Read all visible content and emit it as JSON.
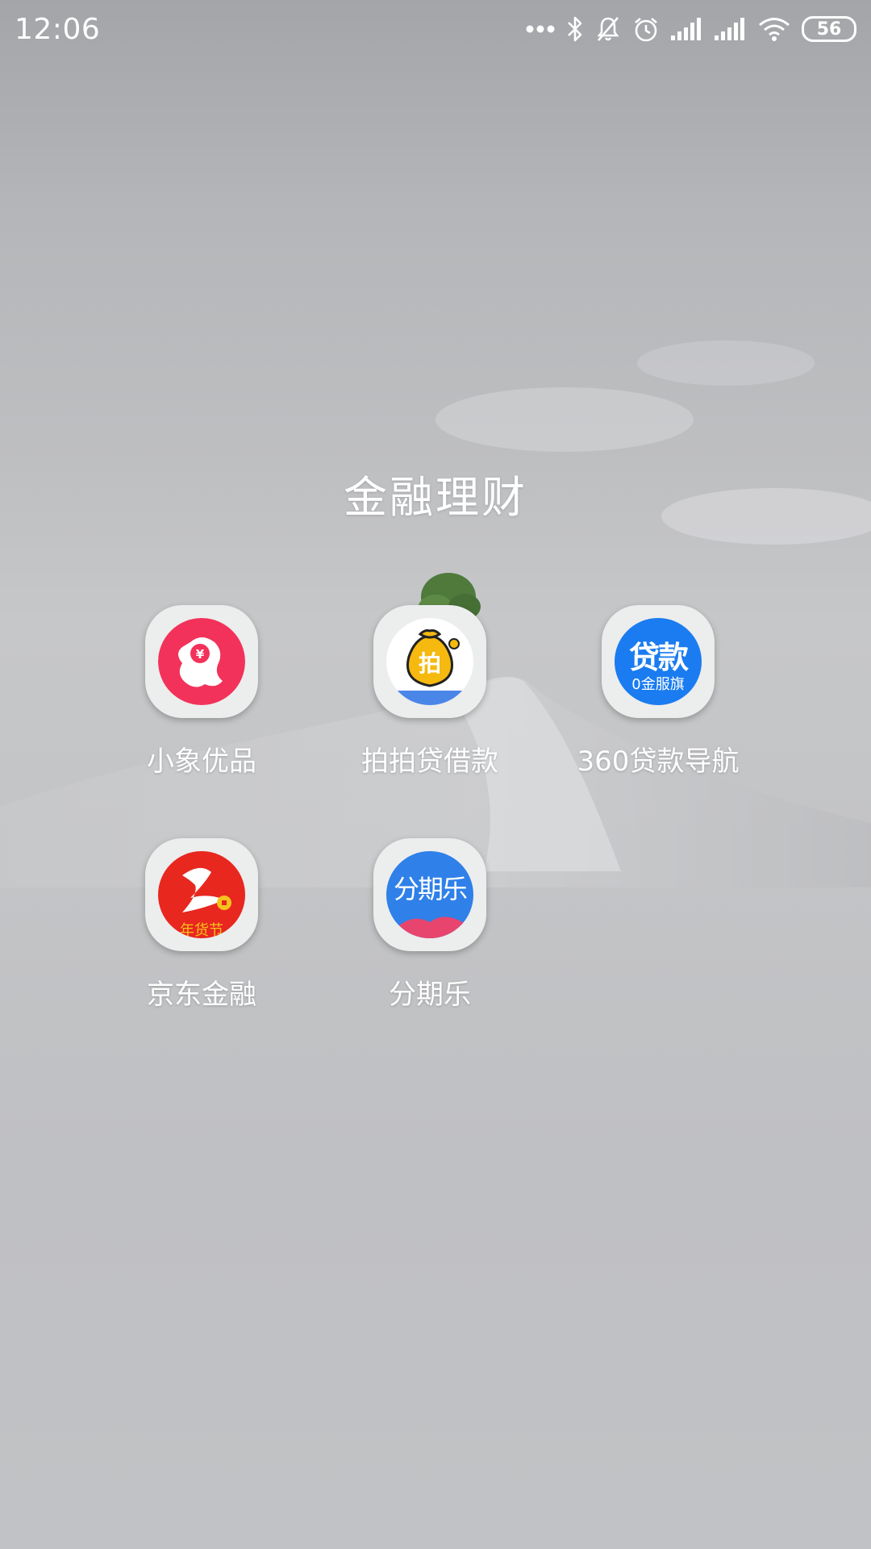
{
  "status_bar": {
    "time": "12:06",
    "battery": "56",
    "icons": [
      "more-dots-icon",
      "bluetooth-icon",
      "notifications-off-icon",
      "alarm-icon",
      "signal-icon",
      "signal-icon",
      "wifi-icon",
      "battery-icon"
    ]
  },
  "folder": {
    "title": "金融理财",
    "apps": [
      {
        "label": "小象优品",
        "icon": "xiaoxiang-app-icon",
        "color": "#f2325a"
      },
      {
        "label": "拍拍贷借款",
        "icon": "paipaidai-app-icon",
        "color": "#f5b90f"
      },
      {
        "label": "360贷款导航",
        "icon": "360-loan-app-icon",
        "color": "#1a7cf0",
        "icon_text": "贷款",
        "icon_subtext": "0金服旗"
      },
      {
        "label": "京东金融",
        "icon": "jd-finance-app-icon",
        "color": "#e8271f",
        "icon_subtext": "年货节"
      },
      {
        "label": "分期乐",
        "icon": "fenqile-app-icon",
        "color": "#2f80e8",
        "icon_text": "分期乐"
      }
    ]
  }
}
